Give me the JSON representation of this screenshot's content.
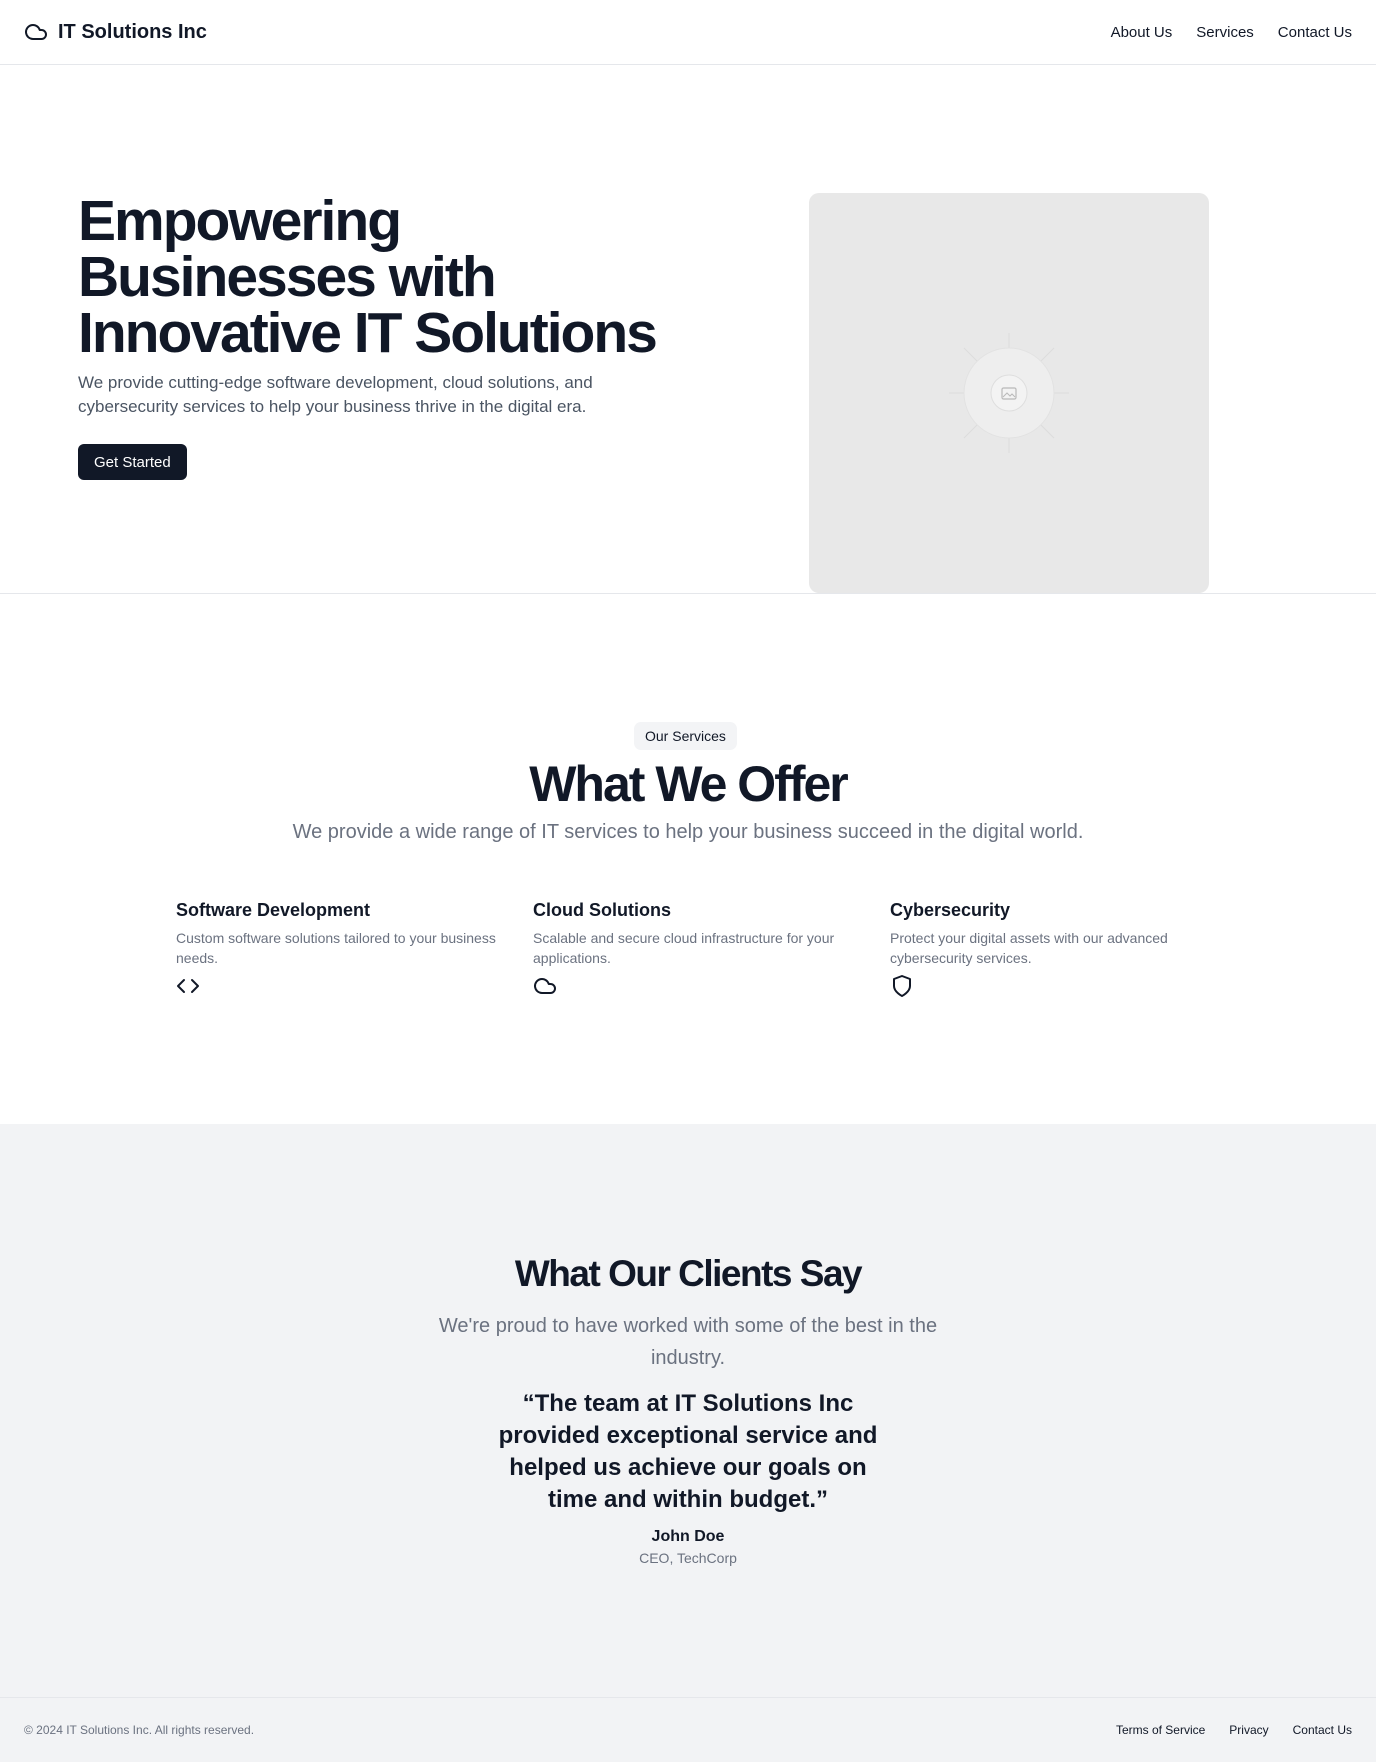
{
  "header": {
    "brand_icon": "cloud-icon",
    "brand_name": "IT Solutions Inc",
    "nav": [
      "About Us",
      "Services",
      "Contact Us"
    ]
  },
  "hero": {
    "title": "Empowering Businesses with Innovative IT Solutions",
    "subtitle": "We provide cutting-edge software development, cloud solutions, and cybersecurity services to help your business thrive in the digital era.",
    "cta_label": "Get Started",
    "image_icon": "image-placeholder-icon"
  },
  "services": {
    "pill": "Our Services",
    "title": "What We Offer",
    "subtitle": "We provide a wide range of IT services to help your business succeed in the digital world.",
    "items": [
      {
        "title": "Software Development",
        "description": "Custom software solutions tailored to your business needs.",
        "icon": "code-icon"
      },
      {
        "title": "Cloud Solutions",
        "description": "Scalable and secure cloud infrastructure for your applications.",
        "icon": "cloud-icon"
      },
      {
        "title": "Cybersecurity",
        "description": "Protect your digital assets with our advanced cybersecurity services.",
        "icon": "shield-icon"
      }
    ]
  },
  "testimonials": {
    "title": "What Our Clients Say",
    "subtitle": "We're proud to have worked with some of the best in the industry.",
    "quote": "“The team at IT Solutions Inc provided exceptional service and helped us achieve our goals on time and within budget.”",
    "author": "John Doe",
    "role": "CEO, TechCorp"
  },
  "footer": {
    "copyright": "© 2024 IT Solutions Inc. All rights reserved.",
    "links": [
      "Terms of Service",
      "Privacy",
      "Contact Us"
    ]
  },
  "colors": {
    "primary": "#111827",
    "muted": "#6b7280",
    "section_bg": "#f2f3f5",
    "border": "#e5e7eb"
  }
}
